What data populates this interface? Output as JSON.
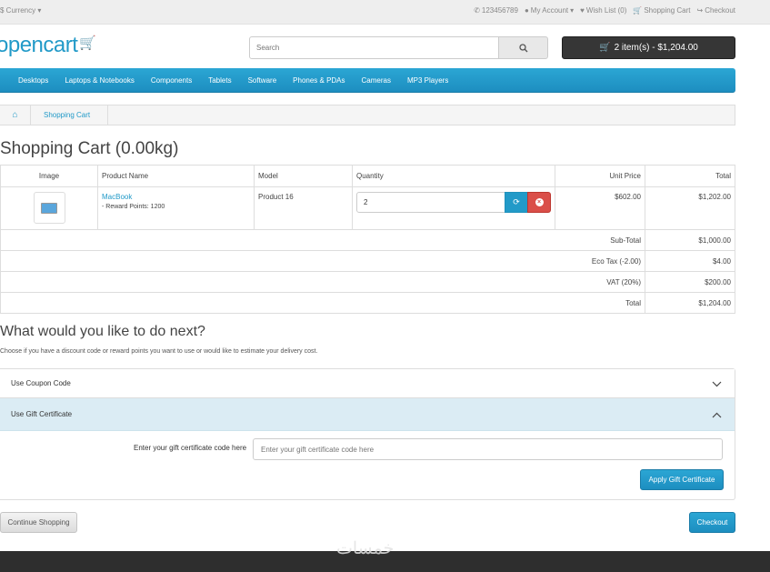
{
  "topbar": {
    "currency": "$ Currency",
    "phone": "123456789",
    "my_account": "My Account",
    "wish_list": "Wish List (0)",
    "shopping_cart": "Shopping Cart",
    "checkout": "Checkout"
  },
  "header": {
    "logo": "opencart",
    "search_placeholder": "Search",
    "cart_button": "2 item(s) - $1,204.00"
  },
  "menu": [
    "Desktops",
    "Laptops & Notebooks",
    "Components",
    "Tablets",
    "Software",
    "Phones & PDAs",
    "Cameras",
    "MP3 Players"
  ],
  "breadcrumb": {
    "current": "Shopping Cart"
  },
  "page_title": "Shopping Cart (0.00kg)",
  "cart": {
    "headers": {
      "image": "Image",
      "product_name": "Product Name",
      "model": "Model",
      "quantity": "Quantity",
      "unit_price": "Unit Price",
      "total": "Total"
    },
    "item": {
      "name": "MacBook",
      "reward": "- Reward Points: 1200",
      "model": "Product 16",
      "quantity": "2",
      "unit_price": "$602.00",
      "total": "$1,202.00"
    },
    "totals": [
      {
        "label": "Sub-Total",
        "value": "$1,000.00"
      },
      {
        "label": "Eco Tax (-2.00)",
        "value": "$4.00"
      },
      {
        "label": "VAT (20%)",
        "value": "$200.00"
      },
      {
        "label": "Total",
        "value": "$1,204.00"
      }
    ]
  },
  "next": {
    "title": "What would you like to do next?",
    "description": "Choose if you have a discount code or reward points you want to use or would like to estimate your delivery cost.",
    "coupon_label": "Use Coupon Code",
    "gift_label": "Use Gift Certificate",
    "gift_field_label": "Enter your gift certificate code here",
    "gift_placeholder": "Enter your gift certificate code here",
    "apply_button": "Apply Gift Certificate"
  },
  "buttons": {
    "continue": "Continue Shopping",
    "checkout": "Checkout"
  },
  "watermark": "خمسات",
  "colors": {
    "accent": "#229ac8",
    "danger": "#da4f49",
    "dark": "#363636"
  }
}
